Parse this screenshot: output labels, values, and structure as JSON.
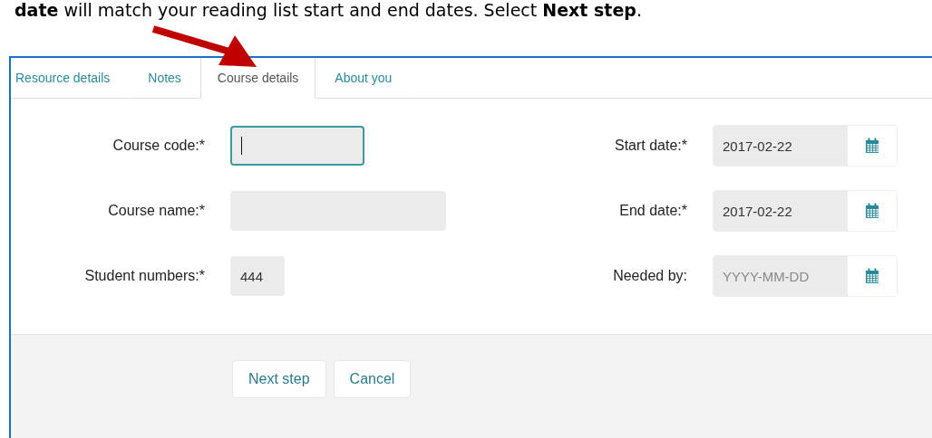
{
  "instruction": "**date** will match your reading list start and end dates.  Select **Next step**.",
  "tabs": [
    {
      "label": "Resource details",
      "selected": false
    },
    {
      "label": "Notes",
      "selected": false
    },
    {
      "label": "Course details",
      "selected": true
    },
    {
      "label": "About you",
      "selected": false
    }
  ],
  "course_fields": [
    {
      "label": "Course code:*",
      "kind": "medium",
      "focused": true
    },
    {
      "label": "Course name:*",
      "kind": "wide",
      "focused": false
    },
    {
      "label": "Student numbers:*",
      "kind": "narrow",
      "value": "444",
      "focused": false
    }
  ],
  "date_fields": [
    {
      "label": "Start date:*",
      "value": "2017-02-22"
    },
    {
      "label": "End date:*",
      "value": "2017-02-22"
    },
    {
      "label": "Needed by:",
      "placeholder": "YYYY-MM-DD"
    }
  ],
  "buttons": [
    "Next step",
    "Cancel"
  ]
}
